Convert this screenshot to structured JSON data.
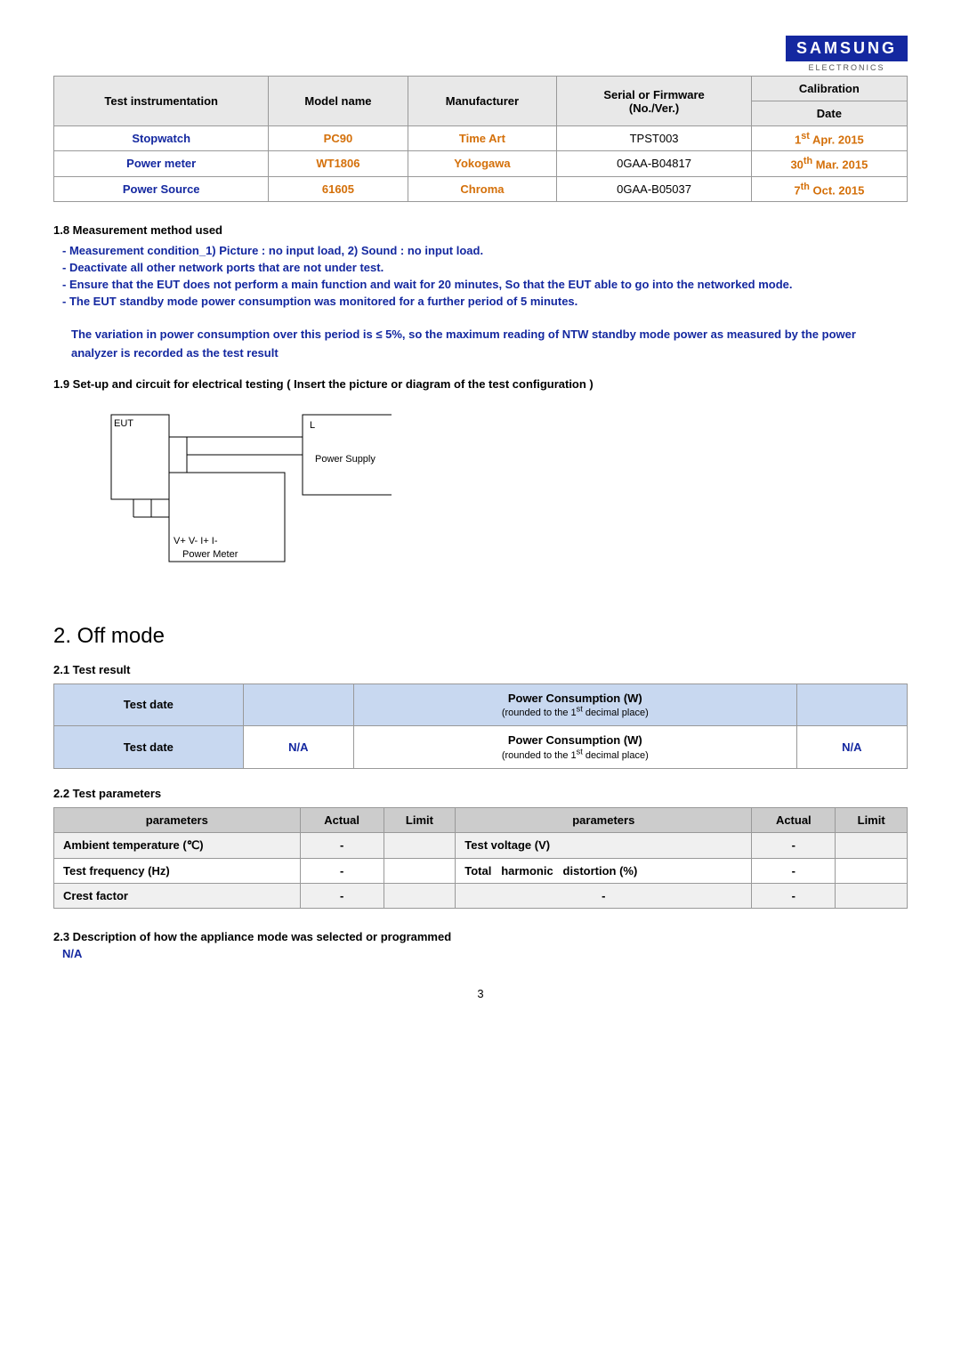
{
  "logo": {
    "brand": "SAMSUNG",
    "sub": "ELECTRONICS"
  },
  "instrumentation_table": {
    "headers": [
      "Test instrumentation",
      "Model name",
      "Manufacturer",
      "Serial or Firmware (No./Ver.)",
      "Calibration Date"
    ],
    "rows": [
      {
        "instrument": "Stopwatch",
        "model": "PC90",
        "manufacturer": "Time Art",
        "serial": "TPST003",
        "calibration": "1",
        "cal_sup": "st",
        "cal_rest": " Apr. 2015"
      },
      {
        "instrument": "Power meter",
        "model": "WT1806",
        "manufacturer": "Yokogawa",
        "serial": "0GAA-B04817",
        "calibration": "30",
        "cal_sup": "th",
        "cal_rest": " Mar. 2015"
      },
      {
        "instrument": "Power Source",
        "model": "61605",
        "manufacturer": "Chroma",
        "serial": "0GAA-B05037",
        "calibration": "7",
        "cal_sup": "th",
        "cal_rest": " Oct. 2015"
      }
    ]
  },
  "measurement": {
    "section_title": "1.8 Measurement method used",
    "bullets": [
      "- Measurement condition_1) Picture : no input load, 2) Sound : no input load.",
      "- Deactivate all other network ports that are not under test.",
      "- Ensure that the EUT does not perform a main function and wait for 20 minutes, So that the EUT able to go into the networked mode.",
      "- The EUT standby mode power consumption was monitored for a further period of 5 minutes."
    ],
    "variation_note": "The variation in power consumption over this period is ≤ 5%, so the maximum reading of NTW standby mode power as measured by the power analyzer is recorded as the test result"
  },
  "circuit": {
    "section_title": "1.9 Set-up and circuit for electrical testing ( Insert the picture or diagram of the test configuration )",
    "labels": {
      "eut": "EUT",
      "power_supply": "Power Supply",
      "power_meter": "Power Meter",
      "terminals": "V+  V-    I+    I-",
      "l_label": "L"
    }
  },
  "off_mode": {
    "heading": "2. Off mode",
    "test_result_section": "2.1 Test result",
    "table": {
      "headers": [
        "Test date",
        "",
        "Power Consumption (W)",
        "(rounded to the 1st decimal place)",
        ""
      ],
      "row": {
        "test_date_label": "Test date",
        "test_date_value": "N/A",
        "power_label": "Power Consumption (W)",
        "power_sub": "(rounded to the 1st decimal place)",
        "power_value": "N/A"
      }
    },
    "test_params_section": "2.2 Test parameters",
    "params_table": {
      "headers": [
        "parameters",
        "Actual",
        "Limit",
        "parameters",
        "Actual",
        "Limit"
      ],
      "rows": [
        [
          "Ambient temperature (℃)",
          "-",
          "",
          "Test voltage (V)",
          "-",
          ""
        ],
        [
          "Test frequency (Hz)",
          "-",
          "",
          "Total harmonic distortion (%)",
          "-",
          ""
        ],
        [
          "Crest factor",
          "-",
          "",
          "-",
          "-",
          ""
        ]
      ]
    },
    "description_section": "2.3 Description of how the appliance mode was selected or programmed",
    "description_value": "N/A"
  },
  "page_number": "3"
}
